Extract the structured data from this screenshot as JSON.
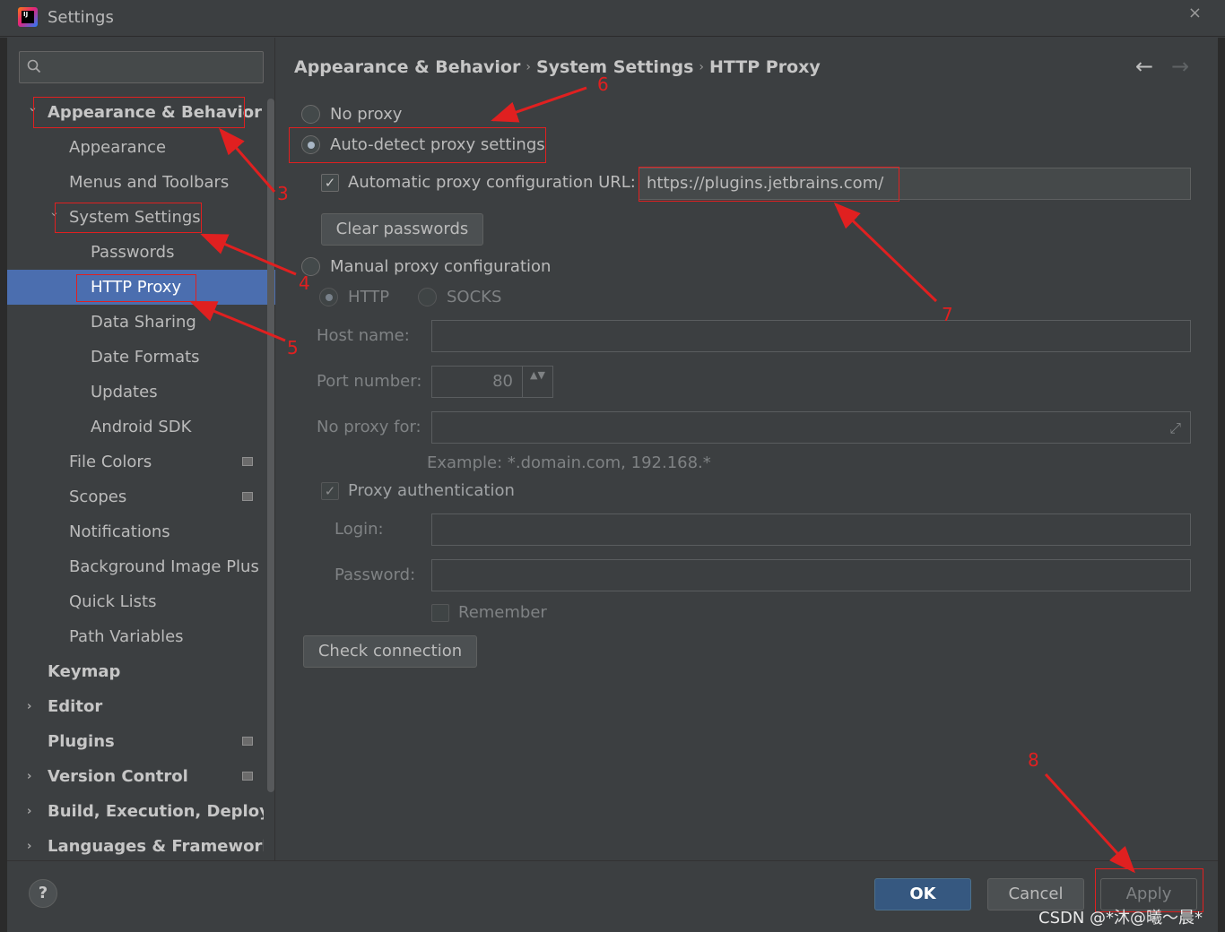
{
  "window": {
    "title": "Settings",
    "close_glyph": "×"
  },
  "search": {
    "placeholder": "",
    "icon": "search-icon"
  },
  "tree": [
    {
      "label": "Appearance & Behavior",
      "arrow": "›"
    },
    {
      "label": "Appearance"
    },
    {
      "label": "Menus and Toolbars"
    },
    {
      "label": "System Settings",
      "arrow": "›"
    },
    {
      "label": "Passwords"
    },
    {
      "label": "HTTP Proxy"
    },
    {
      "label": "Data Sharing"
    },
    {
      "label": "Date Formats"
    },
    {
      "label": "Updates"
    },
    {
      "label": "Android SDK"
    },
    {
      "label": "File Colors"
    },
    {
      "label": "Scopes"
    },
    {
      "label": "Notifications"
    },
    {
      "label": "Background Image Plus"
    },
    {
      "label": "Quick Lists"
    },
    {
      "label": "Path Variables"
    },
    {
      "label": "Keymap"
    },
    {
      "label": "Editor",
      "arrow": "›"
    },
    {
      "label": "Plugins"
    },
    {
      "label": "Version Control",
      "arrow": "›"
    },
    {
      "label": "Build, Execution, Deployment",
      "arrow": "›"
    },
    {
      "label": "Languages & Frameworks",
      "arrow": "›"
    }
  ],
  "breadcrumb": {
    "part1": "Appearance & Behavior",
    "part2": "System Settings",
    "part3": "HTTP Proxy",
    "sep": "›"
  },
  "nav": {
    "back": "←",
    "forward": "→"
  },
  "proxy": {
    "no_proxy": "No proxy",
    "auto_detect": "Auto-detect proxy settings",
    "auto_url_label": "Automatic proxy configuration URL:",
    "auto_url_value": "https://plugins.jetbrains.com/",
    "auto_url_checked": "✓",
    "clear_passwords": "Clear passwords",
    "manual": "Manual proxy configuration",
    "http": "HTTP",
    "socks": "SOCKS",
    "host_label": "Host name:",
    "port_label": "Port number:",
    "port_value": "80",
    "spinner_glyph": "▲▼",
    "no_proxy_for_label": "No proxy for:",
    "expand_glyph": "⤢",
    "example": "Example: *.domain.com, 192.168.*",
    "proxy_auth_label": "Proxy authentication",
    "proxy_auth_checked": "✓",
    "login_label": "Login:",
    "password_label": "Password:",
    "remember_label": "Remember",
    "check_connection": "Check connection"
  },
  "footer": {
    "help": "?",
    "ok": "OK",
    "cancel": "Cancel",
    "apply": "Apply"
  },
  "annotations": [
    "3",
    "4",
    "5",
    "6",
    "7",
    "8"
  ],
  "watermark": "CSDN @*沐@曦～晨*",
  "colors": {
    "background": "#3c3f41",
    "selection": "#4b6eaf",
    "ok_button": "#365880",
    "annotation": "#e02020"
  }
}
